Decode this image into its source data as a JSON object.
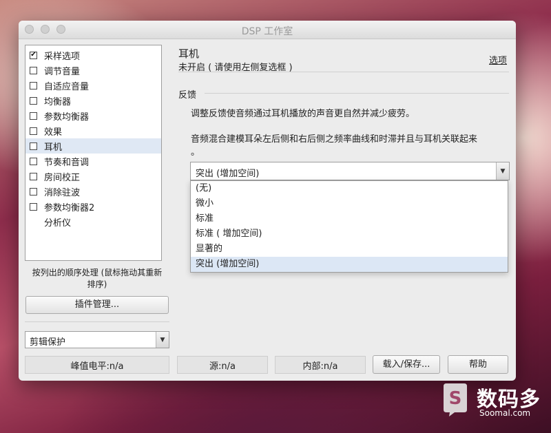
{
  "window": {
    "title": "DSP 工作室"
  },
  "sidebar": {
    "items": [
      {
        "label": "采样选项",
        "checked": true
      },
      {
        "label": "调节音量",
        "checked": false
      },
      {
        "label": "自适应音量",
        "checked": false
      },
      {
        "label": "均衡器",
        "checked": false
      },
      {
        "label": "参数均衡器",
        "checked": false
      },
      {
        "label": "效果",
        "checked": false
      },
      {
        "label": "耳机",
        "checked": false,
        "selected": true
      },
      {
        "label": "节奏和音调",
        "checked": false
      },
      {
        "label": "房间校正",
        "checked": false
      },
      {
        "label": "消除驻波",
        "checked": false
      },
      {
        "label": "参数均衡器2",
        "checked": false
      },
      {
        "label": "分析仪",
        "checkbox": false
      }
    ],
    "order_note_line1": "按列出的顺序处理 (鼠标拖动其重新",
    "order_note_line2": "排序)",
    "plugin_button": "插件管理...",
    "preset_select": "剪辑保护"
  },
  "panel": {
    "title": "耳机",
    "subtitle": "未开启 ( 请使用左侧复选框 )",
    "options_link": "选项",
    "section_title": "反馈",
    "desc1": "调整反馈使音频通过耳机播放的声音更自然并减少疲劳。",
    "desc2_line1": "音频混合建模耳朵左后侧和右后侧之频率曲线和时滞并且与耳机关联起来",
    "desc2_line2": "。",
    "select_value": "突出 (增加空间)",
    "dropdown_options": [
      "(无)",
      "微小",
      "标准",
      "标准 ( 增加空间)",
      "显著的",
      "突出 (增加空间)"
    ],
    "dropdown_selected": 5
  },
  "status": {
    "peak": "峰值电平:n/a",
    "source": "源:n/a",
    "internal": "内部:n/a",
    "load_save": "载入/保存...",
    "help": "帮助"
  },
  "watermark": {
    "name": "数码多",
    "url": "Soomal.com"
  }
}
